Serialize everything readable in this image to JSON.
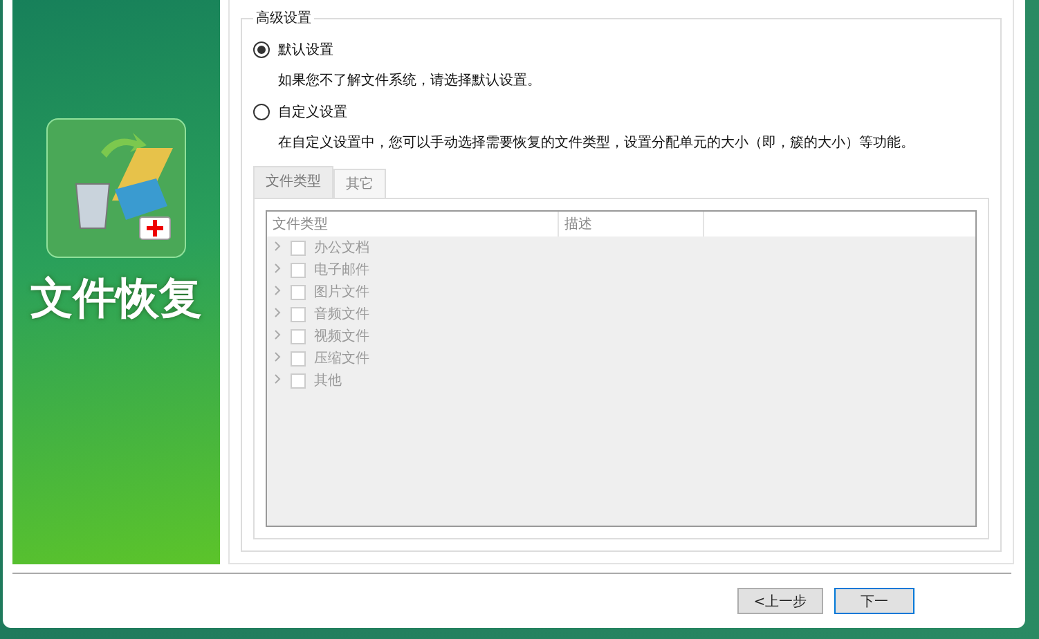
{
  "sidebar": {
    "title": "文件恢复"
  },
  "group": {
    "title": "高级设置",
    "options": [
      {
        "label": "默认设置",
        "selected": true,
        "description": "如果您不了解文件系统，请选择默认设置。"
      },
      {
        "label": "自定义设置",
        "selected": false,
        "description": "在自定义设置中，您可以手动选择需要恢复的文件类型，设置分配单元的大小（即，簇的大小）等功能。"
      }
    ],
    "tabs": [
      {
        "label": "文件类型",
        "selected": true
      },
      {
        "label": "其它",
        "selected": false
      }
    ],
    "table": {
      "disabled": true,
      "columns": [
        "文件类型",
        "描述"
      ],
      "rows": [
        {
          "label": "办公文档",
          "checked": false,
          "expanded": false
        },
        {
          "label": "电子邮件",
          "checked": false,
          "expanded": false
        },
        {
          "label": "图片文件",
          "checked": false,
          "expanded": false
        },
        {
          "label": "音频文件",
          "checked": false,
          "expanded": false
        },
        {
          "label": "视频文件",
          "checked": false,
          "expanded": false
        },
        {
          "label": "压缩文件",
          "checked": false,
          "expanded": false
        },
        {
          "label": "其他",
          "checked": false,
          "expanded": false
        }
      ]
    }
  },
  "buttons": [
    {
      "label": "<上一步",
      "selected": false
    },
    {
      "label": "下一",
      "selected": true
    }
  ]
}
